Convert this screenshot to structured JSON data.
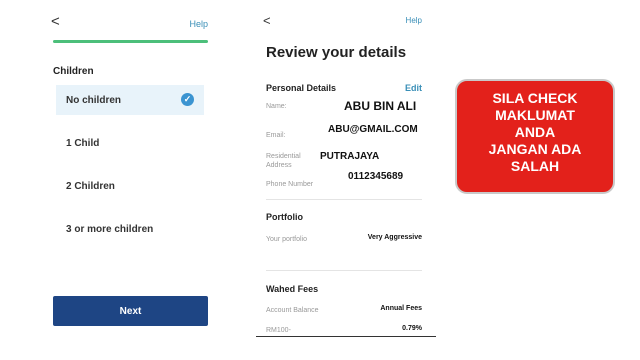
{
  "left": {
    "back_icon": "chevron-left-icon",
    "back_glyph": "<",
    "help": "Help",
    "progress_color": "#4cbf7a",
    "section_label": "Children",
    "options": [
      {
        "label": "No children",
        "selected": true
      },
      {
        "label": "1 Child",
        "selected": false
      },
      {
        "label": "2 Children",
        "selected": false
      },
      {
        "label": "3 or more children",
        "selected": false
      }
    ],
    "next_label": "Next"
  },
  "review": {
    "back_glyph": "<",
    "help": "Help",
    "title": "Review your details",
    "personal_details": "Personal Details",
    "edit": "Edit",
    "name_label": "Name:",
    "name_value": "ABU BIN ALI",
    "email_label": "Email:",
    "email_value": "ABU@GMAIL.COM",
    "address_label": "Residential Address",
    "address_value": "PUTRAJAYA",
    "phone_label": "Phone Number",
    "phone_value": "0112345689",
    "portfolio_title": "Portfolio",
    "portfolio_label": "Your portfolio",
    "portfolio_value": "Very Aggressive",
    "fees_title": "Wahed Fees",
    "account_balance_label": "Account Balance",
    "annual_fees_label": "Annual Fees",
    "balance_value": "RM100-",
    "fee_value": "0.79%"
  },
  "banner": {
    "lines": [
      "SILA CHECK",
      "MAKLUMAT",
      "ANDA",
      "JANGAN ADA",
      "SALAH"
    ],
    "color": "#e3211b"
  }
}
